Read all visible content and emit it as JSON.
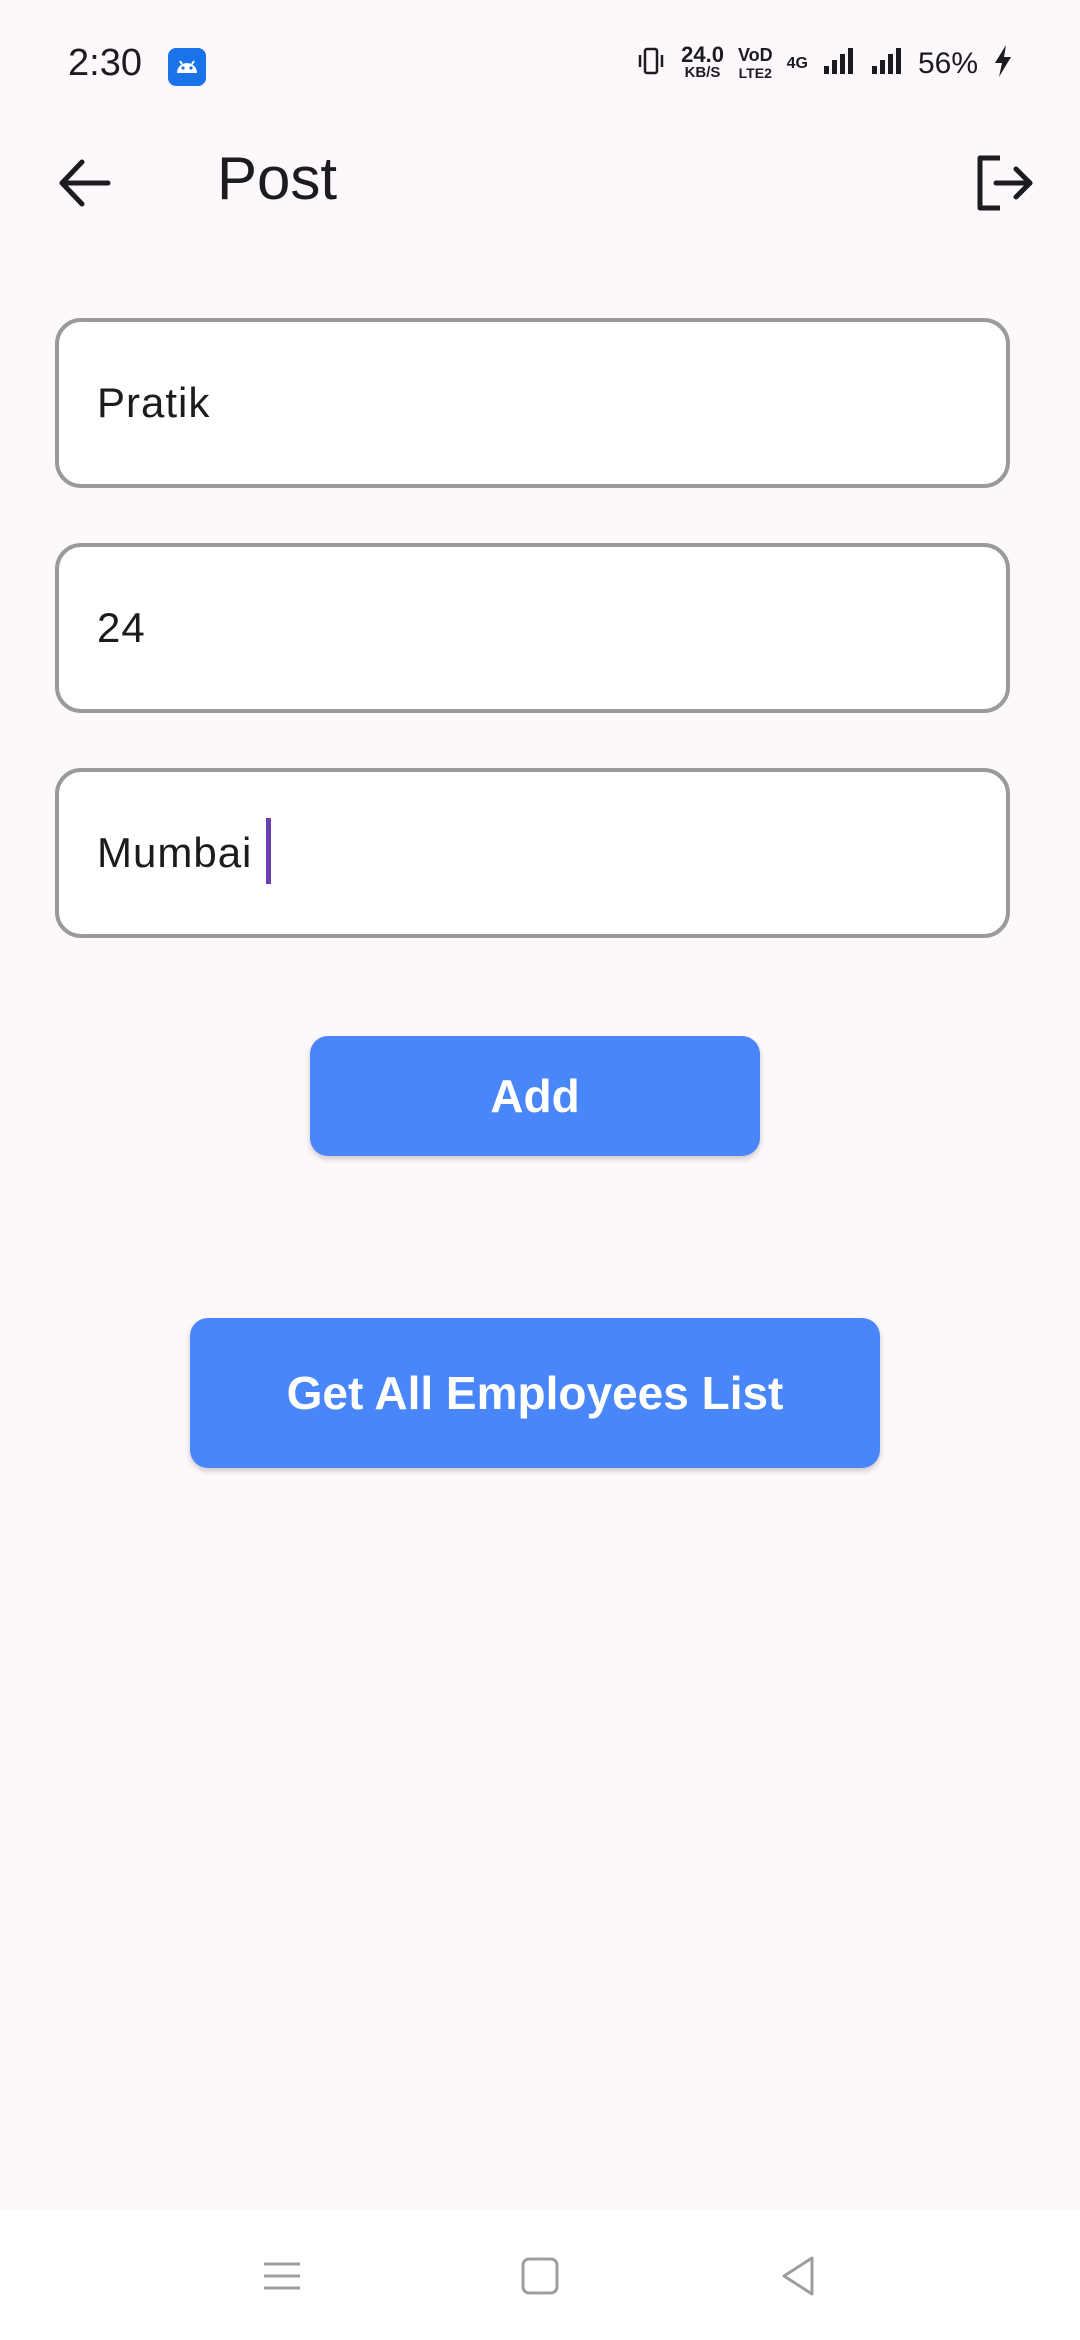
{
  "status_bar": {
    "time": "2:30",
    "net_speed_value": "24.0",
    "net_speed_unit": "KB/S",
    "volte_top": "VoD",
    "volte_bottom": "LTE2",
    "network_type": "4G",
    "battery": "56%",
    "icons": [
      "android-notification-icon",
      "vibrate-icon",
      "signal-icon",
      "signal-icon",
      "charging-icon"
    ]
  },
  "app_bar": {
    "title": "Post",
    "back_icon": "arrow-left-icon",
    "logout_icon": "logout-icon"
  },
  "form": {
    "name_value": "Pratik",
    "age_value": "24",
    "city_value": "Mumbai"
  },
  "buttons": {
    "add_label": "Add",
    "get_all_label": "Get All Employees List"
  },
  "nav_bar": {
    "icons": [
      "menu-icon",
      "home-icon",
      "back-icon"
    ]
  },
  "colors": {
    "background": "#fdf8fc",
    "button": "#4886fa",
    "cursor": "#6a3fb0",
    "field_border": "#9a9a9a"
  }
}
